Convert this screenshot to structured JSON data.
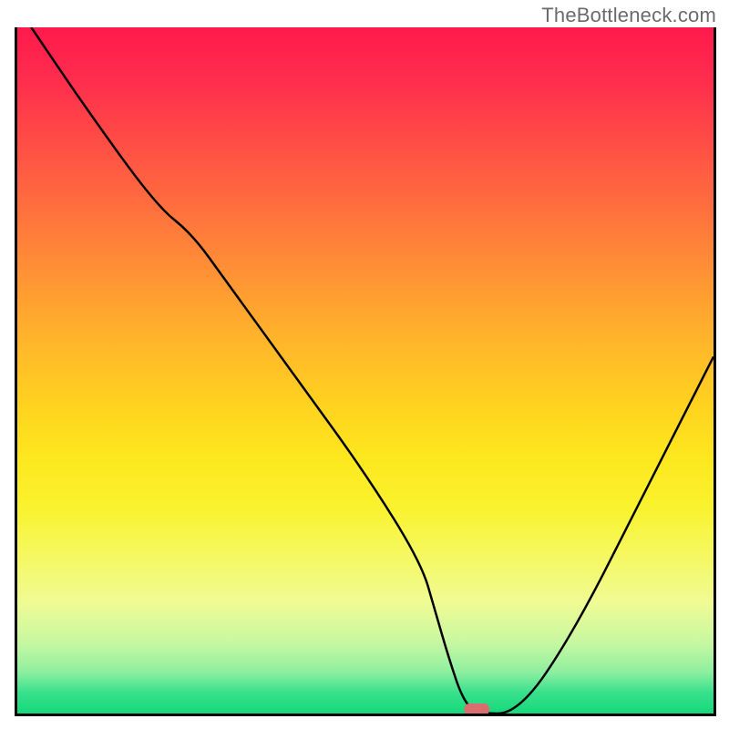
{
  "watermark": "TheBottleneck.com",
  "chart_data": {
    "type": "line",
    "title": "",
    "xlabel": "",
    "ylabel": "",
    "xlim": [
      0,
      100
    ],
    "ylim": [
      0,
      100
    ],
    "x": [
      2,
      10,
      20,
      25,
      30,
      40,
      50,
      58,
      60,
      62,
      64,
      66,
      72,
      80,
      90,
      100
    ],
    "values": [
      100,
      88,
      74,
      70,
      63,
      49,
      35,
      22,
      15,
      8,
      2,
      0,
      0,
      12,
      32,
      52
    ],
    "marker": {
      "x": 66,
      "y": 0
    },
    "gradient_stops": [
      {
        "pct": 0,
        "color": "#ff1a4d"
      },
      {
        "pct": 25,
        "color": "#ff6a3f"
      },
      {
        "pct": 55,
        "color": "#ffd21f"
      },
      {
        "pct": 76,
        "color": "#f6f85a"
      },
      {
        "pct": 100,
        "color": "#16d97a"
      }
    ]
  }
}
